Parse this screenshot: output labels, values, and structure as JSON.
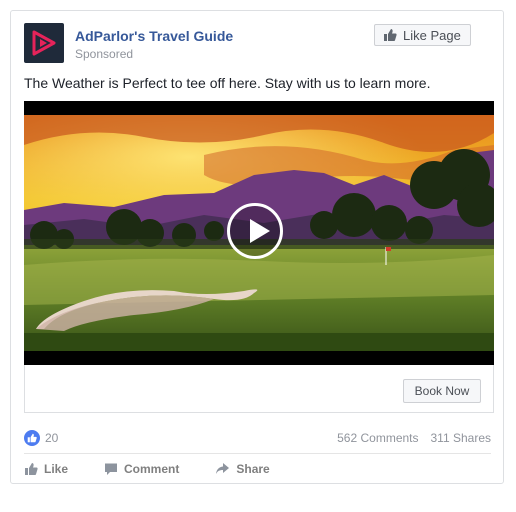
{
  "post": {
    "page_name": "AdParlor's Travel Guide",
    "sponsored_label": "Sponsored",
    "like_page_label": "Like Page",
    "text": "The Weather is Perfect to tee off here. Stay with us to learn more.",
    "cta_label": "Book Now",
    "reaction_count": "20",
    "comments_count": "562 Comments",
    "shares_count": "311 Shares"
  },
  "actions": {
    "like": "Like",
    "comment": "Comment",
    "share": "Share"
  },
  "icons": {
    "avatar": "play-logo-icon",
    "like_page": "thumbs-up-icon",
    "video": "play-icon",
    "reaction": "like-reaction-icon",
    "like": "thumbs-up-icon",
    "comment": "comment-icon",
    "share": "share-arrow-icon"
  },
  "colors": {
    "link_blue": "#365899",
    "reaction_blue": "#4d7cf0",
    "avatar_bg": "#1f2a3a",
    "logo_accent": "#e6235a"
  }
}
